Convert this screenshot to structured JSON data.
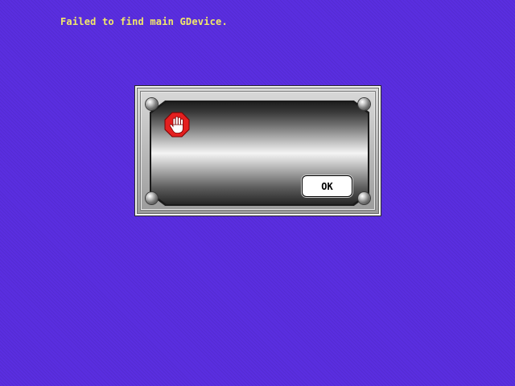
{
  "screen": {
    "background_color": "#5a2ee0",
    "message": "Failed to find main GDevice.",
    "message_color": "#f2e86a"
  },
  "dialog": {
    "icon": "stop-hand-icon",
    "icon_color": "#e41f1f",
    "ok_label": "OK"
  }
}
